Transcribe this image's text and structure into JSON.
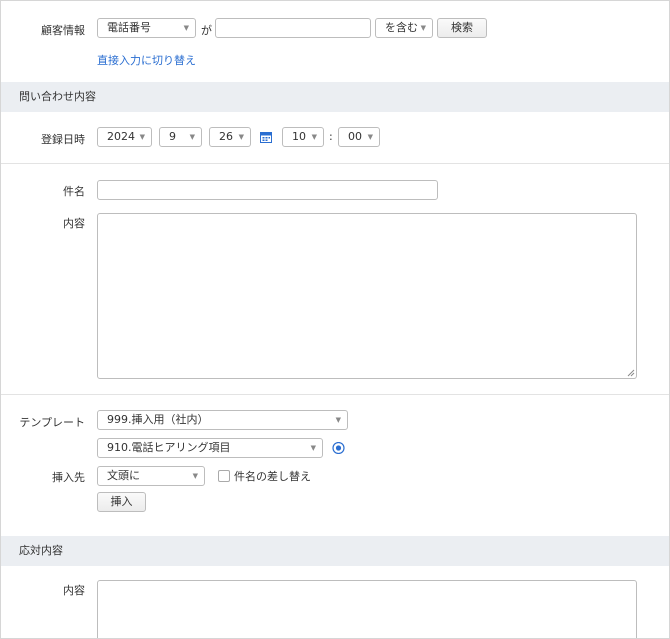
{
  "customer": {
    "label": "顧客情報",
    "field_select": "電話番号",
    "particle": "が",
    "search_value": "",
    "match_select": "を含む",
    "search_button": "検索",
    "direct_input_link": "直接入力に切り替え"
  },
  "inquiry_section": {
    "title": "問い合わせ内容"
  },
  "registration": {
    "label": "登録日時",
    "year": "2024",
    "month": "9",
    "day": "26",
    "hour": "10",
    "time_separator": ":",
    "minute": "00"
  },
  "subject": {
    "label": "件名",
    "value": ""
  },
  "content": {
    "label": "内容",
    "value": ""
  },
  "template": {
    "label": "テンプレート",
    "category_select": "999.挿入用（社内）",
    "item_select": "910.電話ヒアリング項目"
  },
  "insert": {
    "label": "挿入先",
    "position_select": "文頭に",
    "replace_subject_label": "件名の差し替え",
    "insert_button": "挿入"
  },
  "response_section": {
    "title": "応対内容"
  },
  "response": {
    "label": "内容",
    "value": ""
  }
}
